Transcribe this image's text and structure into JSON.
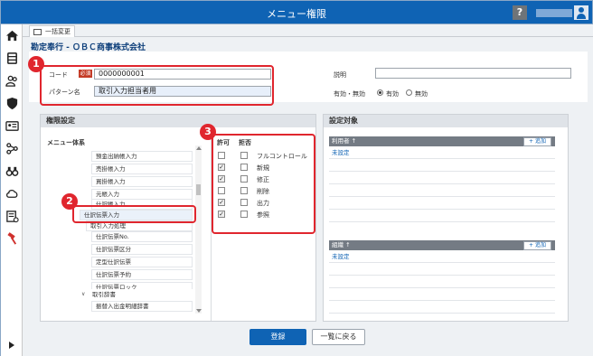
{
  "window": {
    "title": "メニュー権限",
    "help_label": "?"
  },
  "tab": {
    "label": "一括変更"
  },
  "page": {
    "heading": "勘定奉行 - ＯＢＣ商事株式会社"
  },
  "form": {
    "code_label": "コード",
    "required_badge": "必須",
    "code_value": "0000000001",
    "pattern_label": "パターン名",
    "pattern_value": "取引入力担当者用",
    "description_label": "説明",
    "description_value": "",
    "status_label": "有効・無効",
    "status_options": [
      "有効",
      "無効"
    ],
    "status_selected": "有効"
  },
  "permissions": {
    "title": "権限設定",
    "menu_column": "メニュー体系",
    "allow_column": "許可",
    "deny_column": "拒否",
    "tree_items": [
      "預金出納帳入力",
      "売掛帳入力",
      "買掛帳入力",
      "元帳入力",
      "仕訳帳入力",
      "仕訳伝票入力",
      "取引入力処理",
      "仕訳伝票No.",
      "仕訳伝票区分",
      "定型仕訳伝票",
      "仕訳伝票予約",
      "仕訳伝票ロック",
      "取引辞書",
      "振替入出金明細辞書"
    ],
    "options": [
      {
        "label": "フルコントロール",
        "allow": false,
        "deny": false
      },
      {
        "label": "新規",
        "allow": true,
        "deny": false
      },
      {
        "label": "修正",
        "allow": true,
        "deny": false
      },
      {
        "label": "削除",
        "allow": false,
        "deny": false
      },
      {
        "label": "出力",
        "allow": true,
        "deny": false
      },
      {
        "label": "参照",
        "allow": true,
        "deny": false
      }
    ]
  },
  "targets": {
    "title": "設定対象",
    "users_header": "利用者 ↑",
    "users_first": "未設定",
    "org_header": "組織 ↑",
    "org_first": "未設定",
    "add_label": "追加"
  },
  "buttons": {
    "register": "登録",
    "back": "一覧に戻る"
  },
  "annotations": [
    "1",
    "2",
    "3"
  ],
  "colors": {
    "titlebar": "#0f63b4",
    "accent_red": "#e0262e",
    "panel_bg": "#eef1f4"
  }
}
